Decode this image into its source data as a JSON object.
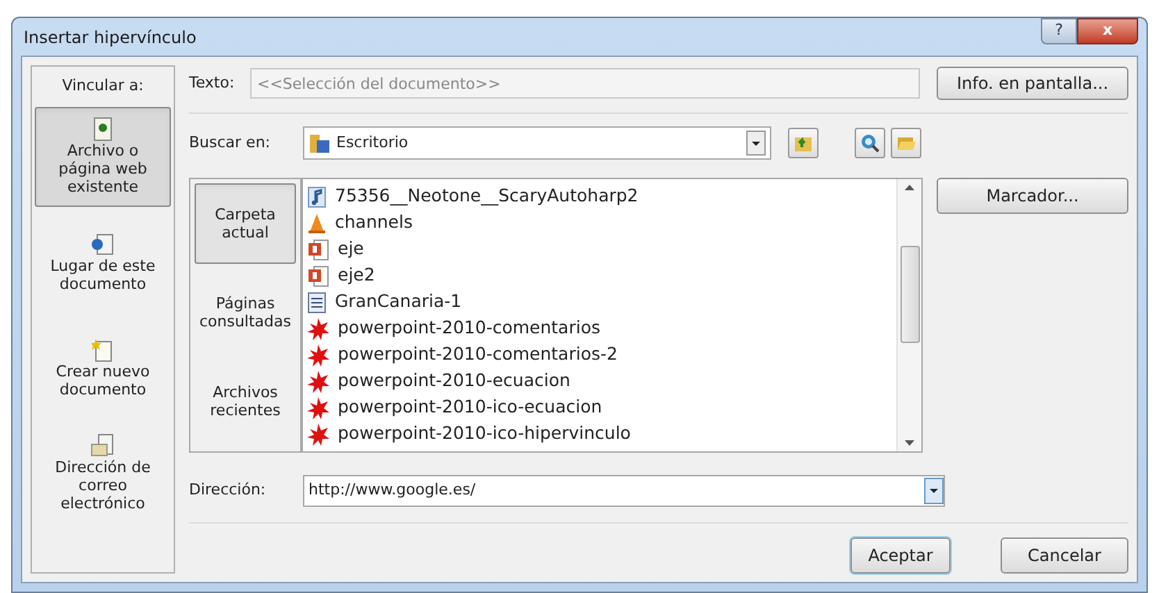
{
  "window": {
    "title": "Insertar hipervínculo",
    "buttons": [
      {
        "kind": "help",
        "label": "?"
      },
      {
        "kind": "close",
        "label": "x"
      }
    ]
  },
  "link_to": {
    "label": "Vincular a:",
    "items": [
      {
        "label": "Archivo o página web existente",
        "kind": "file",
        "selected": true
      },
      {
        "label": "Lugar de este documento",
        "kind": "place",
        "selected": false
      },
      {
        "label": "Crear nuevo documento",
        "kind": "new",
        "selected": false
      },
      {
        "label": "Dirección de correo electrónico",
        "kind": "mail",
        "selected": false
      }
    ]
  },
  "text_field": {
    "label": "Texto:",
    "placeholder": "<<Selección del documento>>"
  },
  "screen_tip_button": "Info. en pantalla...",
  "look_in": {
    "label": "Buscar en:",
    "value": "Escritorio"
  },
  "views": [
    {
      "label": "Carpeta actual",
      "selected": true
    },
    {
      "label": "Páginas consultadas",
      "selected": false
    },
    {
      "label": "Archivos recientes",
      "selected": false
    }
  ],
  "files": [
    {
      "name": "75356__Neotone__ScaryAutoharp2",
      "kind": "audio"
    },
    {
      "name": "channels",
      "kind": "vlc"
    },
    {
      "name": "eje",
      "kind": "ppt"
    },
    {
      "name": "eje2",
      "kind": "ppt"
    },
    {
      "name": "GranCanaria-1",
      "kind": "doc"
    },
    {
      "name": "powerpoint-2010-comentarios",
      "kind": "image"
    },
    {
      "name": "powerpoint-2010-comentarios-2",
      "kind": "image"
    },
    {
      "name": "powerpoint-2010-ecuacion",
      "kind": "image"
    },
    {
      "name": "powerpoint-2010-ico-ecuacion",
      "kind": "image"
    },
    {
      "name": "powerpoint-2010-ico-hipervinculo",
      "kind": "image"
    }
  ],
  "bookmark_button": "Marcador...",
  "address": {
    "label": "Dirección:",
    "value": "http://www.google.es/"
  },
  "buttons": [
    {
      "label": "Aceptar",
      "default": true
    },
    {
      "label": "Cancelar",
      "default": false
    }
  ]
}
